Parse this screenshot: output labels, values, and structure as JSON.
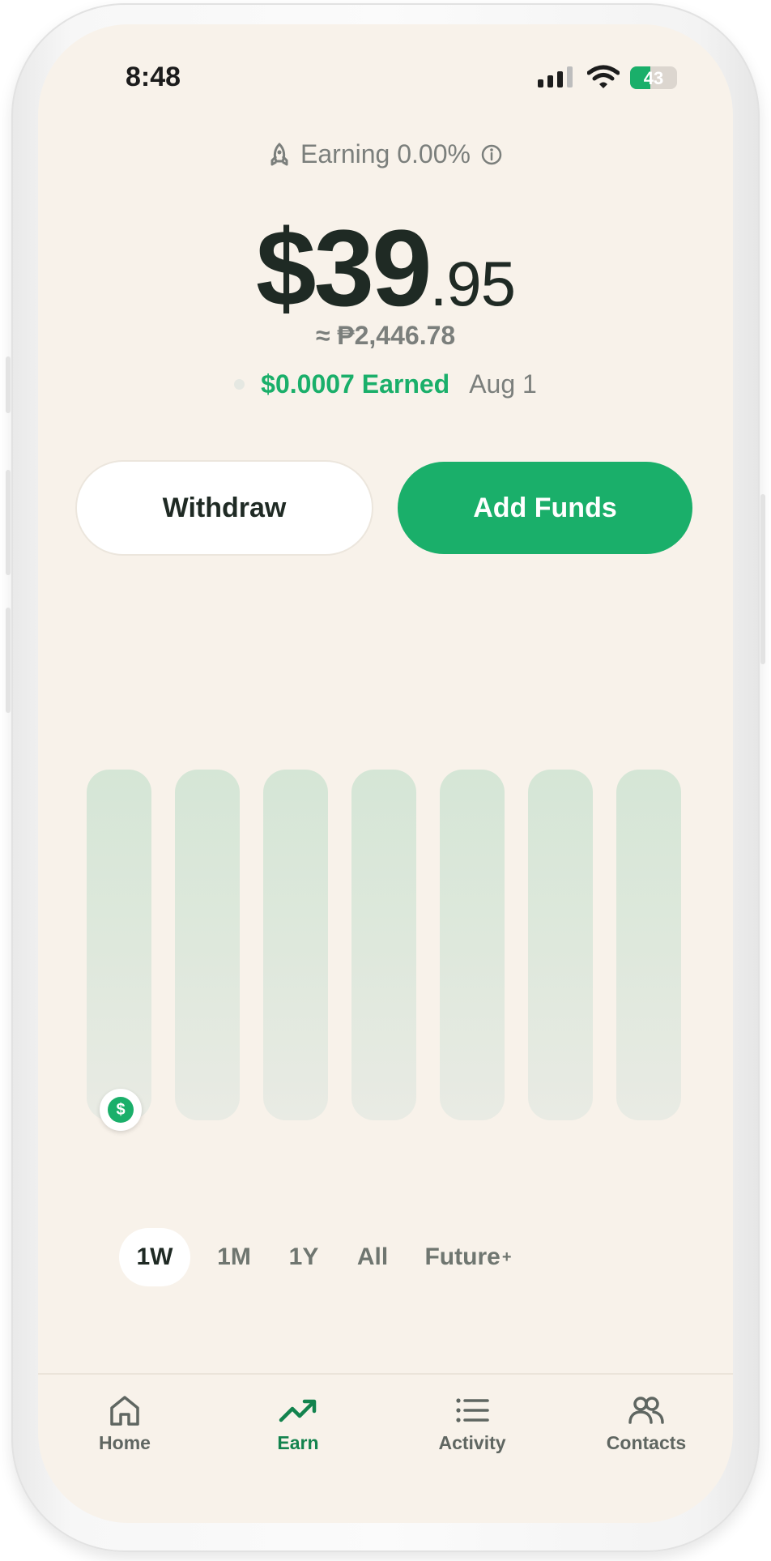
{
  "status_bar": {
    "time": "8:48",
    "battery": "43"
  },
  "header": {
    "earning_label": "Earning 0.00%",
    "balance_whole": "$39",
    "balance_cents": ".95",
    "approx_local": "≈ ₱2,446.78",
    "earned_amount": "$0.0007 Earned",
    "earned_date": "Aug 1"
  },
  "actions": {
    "withdraw": "Withdraw",
    "add_funds": "Add Funds"
  },
  "chart_data": {
    "type": "bar",
    "categories": [
      "",
      "",
      "",
      "",
      "",
      "",
      ""
    ],
    "values": [
      0,
      0,
      0,
      0,
      0,
      0,
      0
    ],
    "title": "",
    "xlabel": "",
    "ylabel": "",
    "grid": false
  },
  "ranges": {
    "items": [
      {
        "label": "1W",
        "active": true
      },
      {
        "label": "1M",
        "active": false
      },
      {
        "label": "1Y",
        "active": false
      },
      {
        "label": "All",
        "active": false
      },
      {
        "label": "Future",
        "suffix": "+",
        "active": false
      }
    ]
  },
  "nav": {
    "items": [
      {
        "label": "Home",
        "icon": "home-icon",
        "active": false
      },
      {
        "label": "Earn",
        "icon": "trend-up-icon",
        "active": true
      },
      {
        "label": "Activity",
        "icon": "list-icon",
        "active": false
      },
      {
        "label": "Contacts",
        "icon": "contacts-icon",
        "active": false
      }
    ]
  },
  "colors": {
    "accent": "#1aaf6a",
    "background": "#f8f2ea",
    "text": "#1f2a24",
    "muted": "#7b7f7c"
  }
}
